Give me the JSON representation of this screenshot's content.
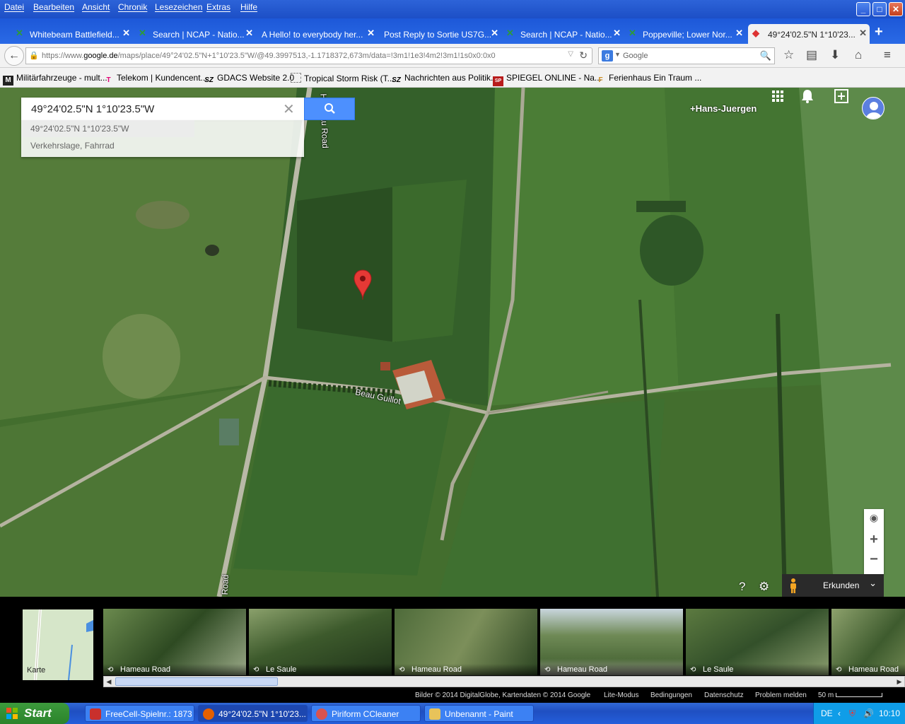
{
  "menu": [
    "Datei",
    "Bearbeiten",
    "Ansicht",
    "Chronik",
    "Lesezeichen",
    "Extras",
    "Hilfe"
  ],
  "window_buttons": {
    "minimize": "_",
    "maximize": "□",
    "close": "✕"
  },
  "tabs": [
    {
      "label": "Whitebeam Battlefield...",
      "icon": "ncap-icon"
    },
    {
      "label": "Search | NCAP - Natio...",
      "icon": "ncap-icon"
    },
    {
      "label": "A Hello! to everybody her...",
      "icon": ""
    },
    {
      "label": "Post Reply to Sortie US7G...",
      "icon": ""
    },
    {
      "label": "Search | NCAP - Natio...",
      "icon": "ncap-icon"
    },
    {
      "label": "Poppeville; Lower Nor...",
      "icon": "ncap-icon"
    },
    {
      "label": "49°24'02.5\"N 1°10'23...",
      "icon": "google-maps-icon",
      "active": true
    }
  ],
  "url": {
    "prefix": "https://www.",
    "host": "google.de",
    "path": "/maps/place/49°24'02.5\"N+1°10'23.5\"W/@49.3997513,-1.1718372,673m/data=!3m1!1e3!4m2!3m1!1s0x0:0x0"
  },
  "browser_search": {
    "placeholder": "Google"
  },
  "bookmarks": [
    {
      "label": "Militärfahrzeuge - mult...",
      "icon": "M"
    },
    {
      "label": "Telekom | Kundencent...",
      "icon": "T"
    },
    {
      "label": "GDACS Website 2.0",
      "icon": "SZ"
    },
    {
      "label": "Tropical Storm Risk (T...",
      "icon": ""
    },
    {
      "label": "Nachrichten aus Politik...",
      "icon": "SZ"
    },
    {
      "label": "SPIEGEL ONLINE - Na...",
      "icon": "SP"
    },
    {
      "label": "Ferienhaus Ein Traum ...",
      "icon": "F"
    }
  ],
  "map_search": {
    "value": "49°24'02.5\"N 1°10'23.5\"W",
    "suggestions": [
      "49°24'02.5\"N 1°10'23.5\"W",
      "Verkehrslage, Fahrrad"
    ]
  },
  "user": {
    "name": "+Hans-Juergen"
  },
  "road_labels": {
    "beau_guillot": "Beau Guillot",
    "hameau_top": "Hameau Road",
    "hameau_bottom": "Road"
  },
  "zoom": {
    "plus": "+",
    "minus": "−"
  },
  "explore": {
    "label": "Erkunden"
  },
  "map_thumb": {
    "label": "Karte"
  },
  "photos": [
    {
      "caption": "Hameau Road"
    },
    {
      "caption": "Le Saule"
    },
    {
      "caption": "Hameau Road"
    },
    {
      "caption": "Hameau Road"
    },
    {
      "caption": "Le Saule"
    },
    {
      "caption": "Hameau Road"
    }
  ],
  "footer": {
    "copyright": "Bilder © 2014 DigitalGlobe, Kartendaten © 2014 Google",
    "links": [
      "Lite-Modus",
      "Bedingungen",
      "Datenschutz",
      "Problem melden"
    ],
    "scale": "50 m"
  },
  "taskbar": {
    "start": "Start",
    "tasks": [
      {
        "label": "FreeCell-Spielnr.: 1873",
        "active": false
      },
      {
        "label": "49°24'02.5\"N 1°10'23....",
        "active": true
      },
      {
        "label": "Piriform CCleaner",
        "active": false
      },
      {
        "label": "Unbenannt - Paint",
        "active": false
      }
    ],
    "language": "DE",
    "clock": "10:10"
  },
  "colors": {
    "accent": "#4d90fe",
    "marker": "#e53935",
    "taskbar": "#245edb",
    "start": "#2b832b"
  }
}
